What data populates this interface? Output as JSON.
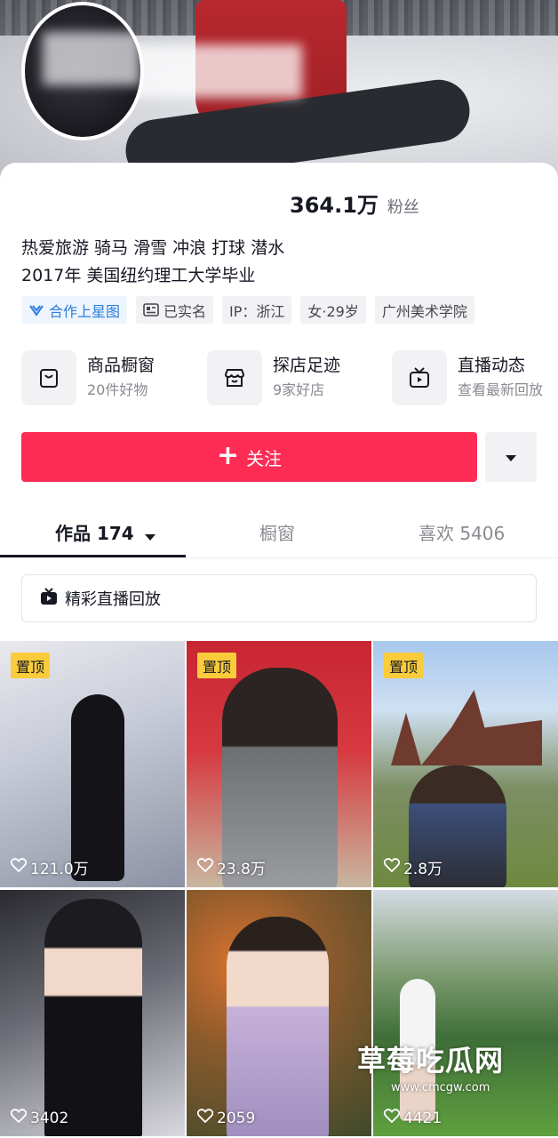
{
  "profile": {
    "fans_count": "364.1万",
    "fans_label": "粉丝",
    "bio_line1": "热爱旅游 骑马 滑雪 冲浪 打球 潜水",
    "bio_line2": "2017年 美国纽约理工大学毕业"
  },
  "tags": [
    {
      "label": "合作上星图",
      "icon": "xingtu-icon"
    },
    {
      "label": "已实名",
      "icon": "id-card-icon"
    },
    {
      "label": "IP：浙江"
    },
    {
      "label": "女·29岁"
    },
    {
      "label": "广州美术学院"
    }
  ],
  "shortcuts": [
    {
      "title": "商品橱窗",
      "subtitle": "20件好物",
      "icon": "shopping-bag-icon"
    },
    {
      "title": "探店足迹",
      "subtitle": "9家好店",
      "icon": "store-icon"
    },
    {
      "title": "直播动态",
      "subtitle": "查看最新回放",
      "icon": "tv-icon"
    }
  ],
  "actions": {
    "follow_label": "关注",
    "more_icon": "triangle-down-icon"
  },
  "tabs": [
    {
      "label": "作品 174",
      "active": true
    },
    {
      "label": "橱窗",
      "active": false
    },
    {
      "label": "喜欢 5406",
      "active": false
    }
  ],
  "replay_banner": {
    "label": "精彩直播回放"
  },
  "videos": [
    {
      "pinned": true,
      "pin_label": "置顶",
      "likes": "121.0万"
    },
    {
      "pinned": true,
      "pin_label": "置顶",
      "likes": "23.8万"
    },
    {
      "pinned": true,
      "pin_label": "置顶",
      "likes": "2.8万"
    },
    {
      "pinned": false,
      "likes": "3402"
    },
    {
      "pinned": false,
      "likes": "2059"
    },
    {
      "pinned": false,
      "likes": "4421"
    }
  ],
  "watermark": {
    "text": "草莓吃瓜网",
    "url": "www.cmcgw.com"
  },
  "colors": {
    "accent": "#fe2c55",
    "pin": "#facc3b",
    "xingtu": "#2c7ddb"
  }
}
